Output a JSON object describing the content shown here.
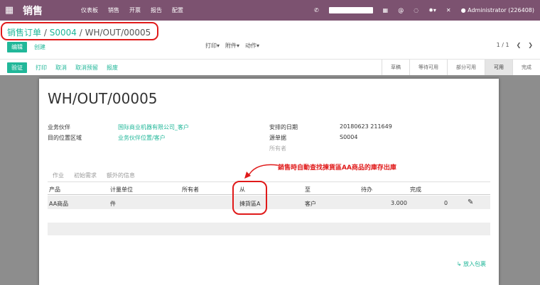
{
  "topbar": {
    "app_title": "销售",
    "menu": [
      "仪表板",
      "销售",
      "开票",
      "报告",
      "配置"
    ],
    "user": "Administrator (226408)"
  },
  "breadcrumb": {
    "root": "销售订单",
    "sep": "/",
    "order": "S0004",
    "current": "WH/OUT/00005"
  },
  "toolbar": {
    "edit": "编辑",
    "create": "创建",
    "print": "打印",
    "attach": "附件",
    "action": "动作",
    "pager": "1 / 1"
  },
  "status_buttons": {
    "validate": "验证",
    "print": "打印",
    "cancel": "取消",
    "cancel_reserve": "取消预留",
    "scrap": "报废"
  },
  "stages": [
    "草稿",
    "等待可用",
    "部分可用",
    "可用",
    "完成"
  ],
  "active_stage": "可用",
  "form": {
    "title": "WH/OUT/00005",
    "partner_label": "业务伙伴",
    "partner_value": "国际商业机器有限公司_客户",
    "dest_label": "目的位置区域",
    "dest_value": "业务伙伴位置/客户",
    "date_label": "安排的日期",
    "date_value": "20180623 211649",
    "origin_label": "源单据",
    "origin_value": "S0004",
    "owner_label": "所有者"
  },
  "tabs": [
    "作业",
    "初始需求",
    "额外的信息"
  ],
  "table": {
    "headers": [
      "产品",
      "计量单位",
      "所有者",
      "从",
      "至",
      "待办",
      "完成"
    ],
    "rows": [
      {
        "product": "AA商品",
        "uom": "件",
        "owner": "",
        "from": "揀貨區A",
        "to": "客户",
        "todo": "3.000",
        "done": "0"
      }
    ]
  },
  "add_note": "放入包裹",
  "annotation": "銷售時自動查找揀貨區AA商品的庫存出庫",
  "colors": {
    "brand": "#7c5270",
    "accent": "#21b799",
    "annotation": "#e01a1a"
  }
}
